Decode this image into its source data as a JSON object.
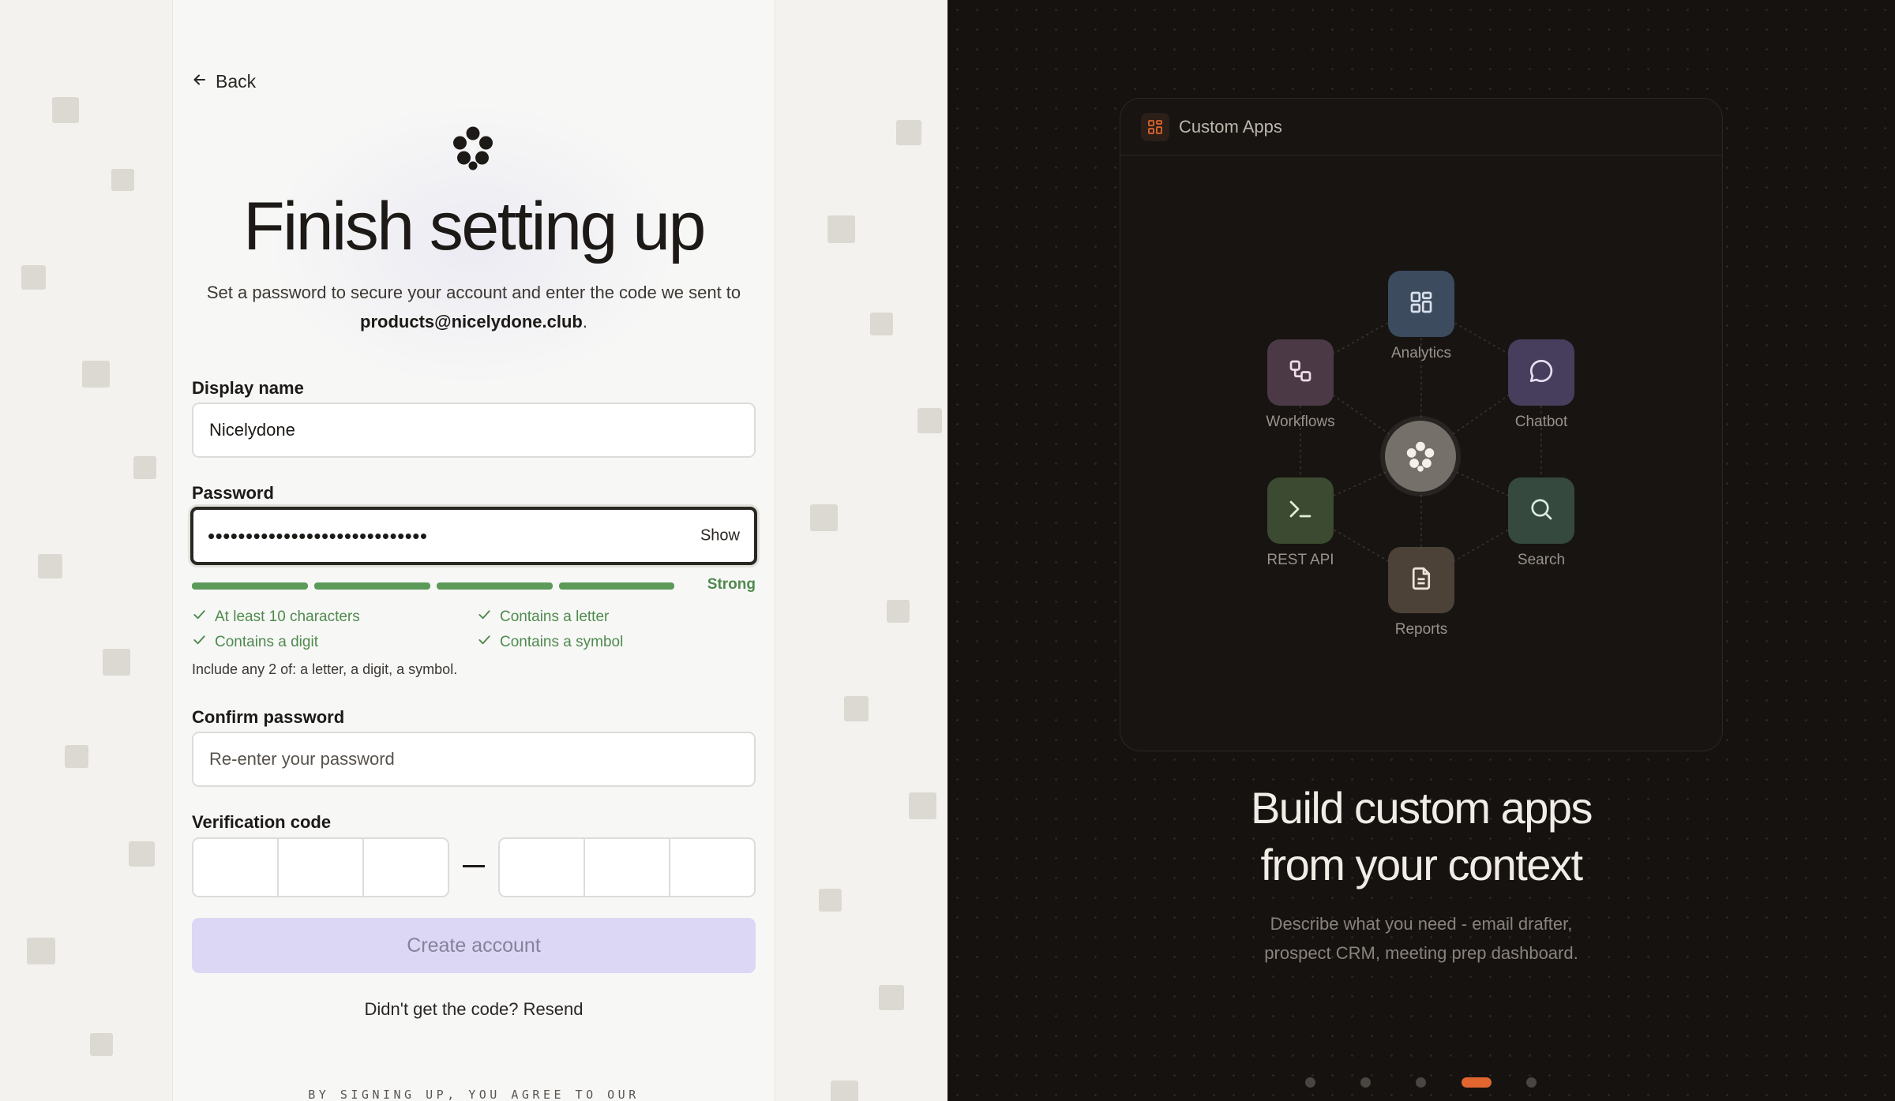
{
  "form": {
    "back_label": "Back",
    "title": "Finish setting up",
    "subtitle_prefix": "Set a password to secure your account and enter the code we sent to",
    "email": "products@nicelydone.club",
    "subtitle_suffix": ".",
    "display_name_label": "Display name",
    "display_name_value": "Nicelydone",
    "password_label": "Password",
    "password_mask": "•••••••••••••••••••••••••••••",
    "show_label": "Show",
    "strength_label": "Strong",
    "strength_segments_filled": 4,
    "requirements": [
      {
        "text": "At least 10 characters",
        "met": true
      },
      {
        "text": "Contains a letter",
        "met": true
      },
      {
        "text": "Contains a digit",
        "met": true
      },
      {
        "text": "Contains a symbol",
        "met": true
      }
    ],
    "hint": "Include any 2 of: a letter, a digit, a symbol.",
    "confirm_label": "Confirm password",
    "confirm_placeholder": "Re-enter your password",
    "verification_label": "Verification code",
    "create_button": "Create account",
    "resend_text": "Didn't get the code? Resend",
    "terms_text": "BY SIGNING UP, YOU AGREE TO OUR"
  },
  "showcase": {
    "panel_title": "Custom Apps",
    "nodes": [
      {
        "label": "Analytics",
        "color": "#3d4b5e"
      },
      {
        "label": "Workflows",
        "color": "#4b3a46"
      },
      {
        "label": "Chatbot",
        "color": "#473d5c"
      },
      {
        "label": "REST API",
        "color": "#3b4a30"
      },
      {
        "label": "Search",
        "color": "#35493e"
      },
      {
        "label": "Reports",
        "color": "#4d4238"
      }
    ],
    "headline_line1": "Build custom apps",
    "headline_line2": "from your context",
    "desc_line1": "Describe what you need - email drafter,",
    "desc_line2": "prospect CRM, meeting prep dashboard.",
    "page_count": 5,
    "active_page": 4,
    "accent_color": "#e0652f"
  }
}
